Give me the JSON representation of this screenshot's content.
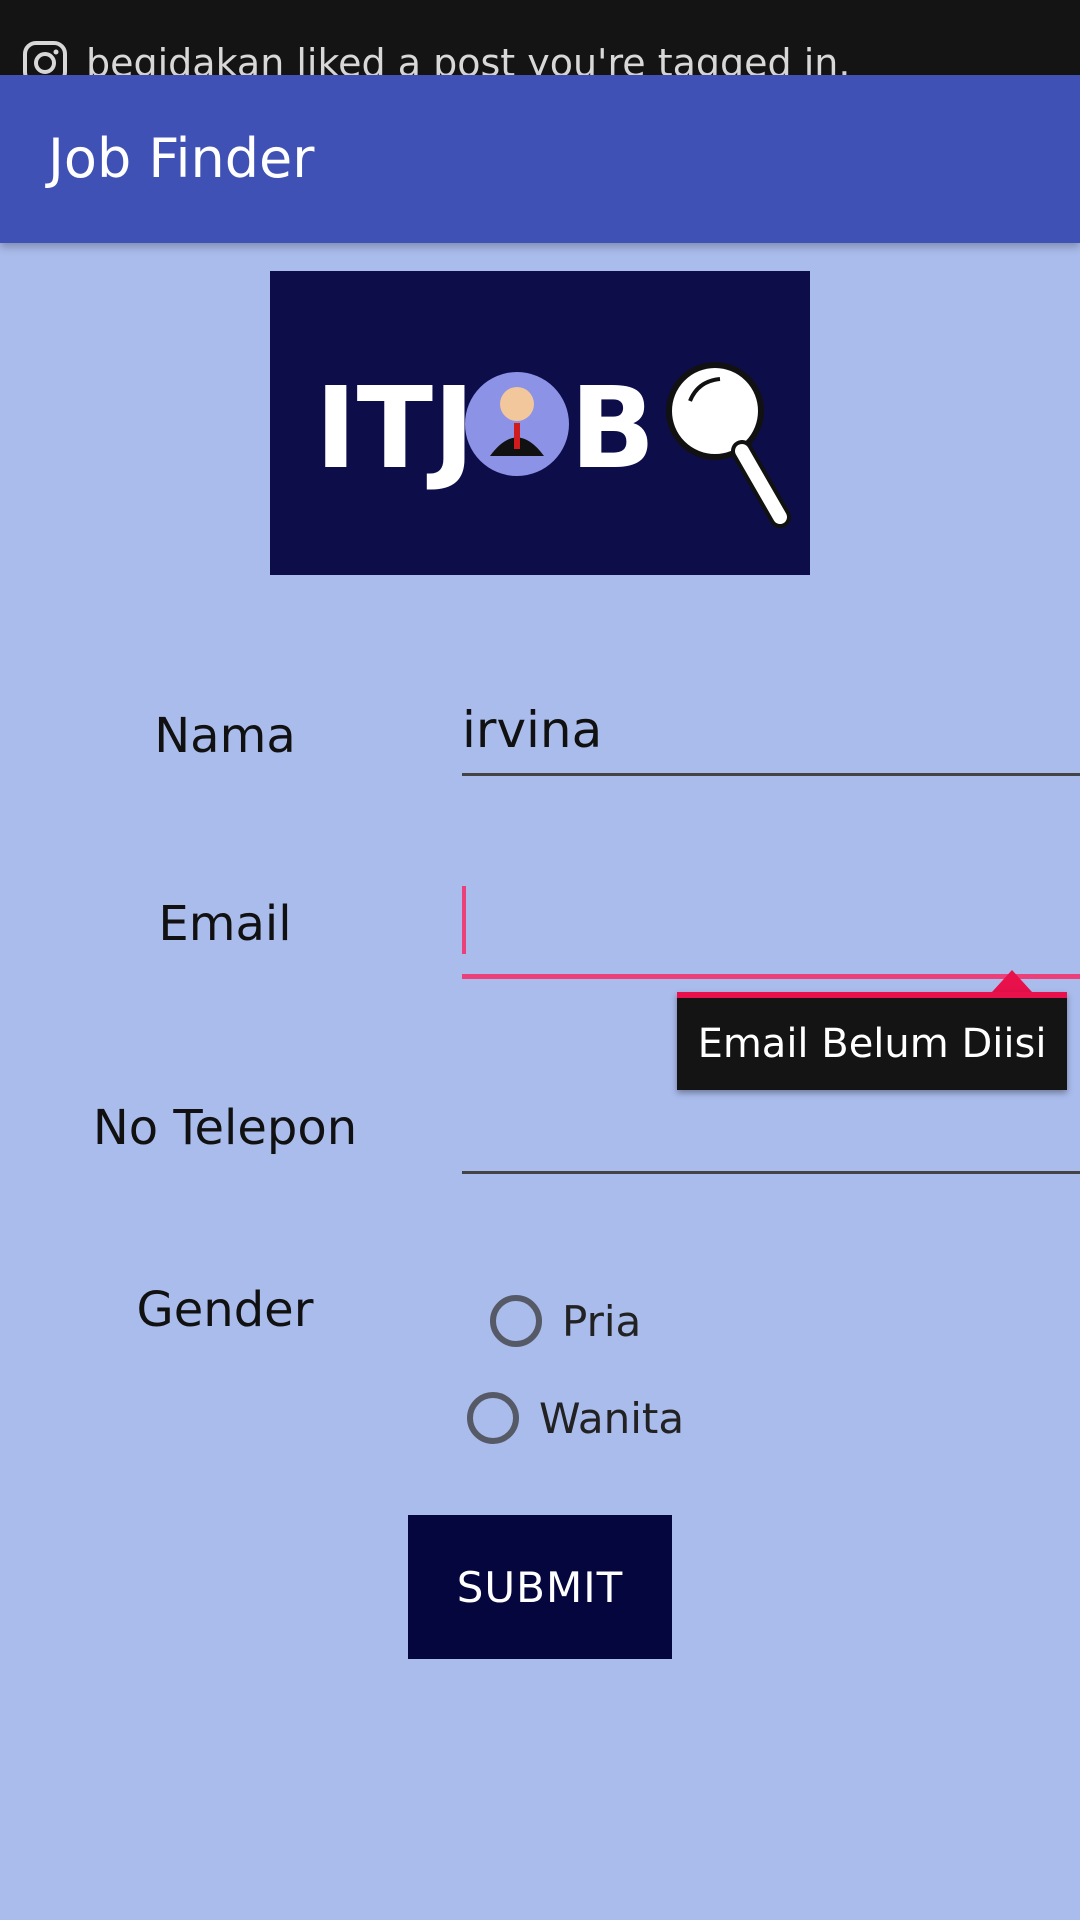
{
  "notification": {
    "icon": "instagram-icon",
    "text": "begidakan liked a post you're tagged in."
  },
  "appbar": {
    "title": "Job Finder"
  },
  "logo": {
    "text": "ITJOB",
    "bg_color": "#0d0d4a"
  },
  "form": {
    "nama": {
      "label": "Nama",
      "value": "irvina"
    },
    "email": {
      "label": "Email",
      "value": "",
      "error": "Email Belum Diisi"
    },
    "telepon": {
      "label": "No Telepon",
      "value": ""
    },
    "gender": {
      "label": "Gender",
      "options": [
        {
          "label": "Pria",
          "checked": false
        },
        {
          "label": "Wanita",
          "checked": false
        }
      ]
    },
    "submit_label": "SUBMIT"
  },
  "colors": {
    "appbar": "#3f51b5",
    "background": "#aabcec",
    "accent": "#ec407a",
    "button": "#05063d"
  }
}
